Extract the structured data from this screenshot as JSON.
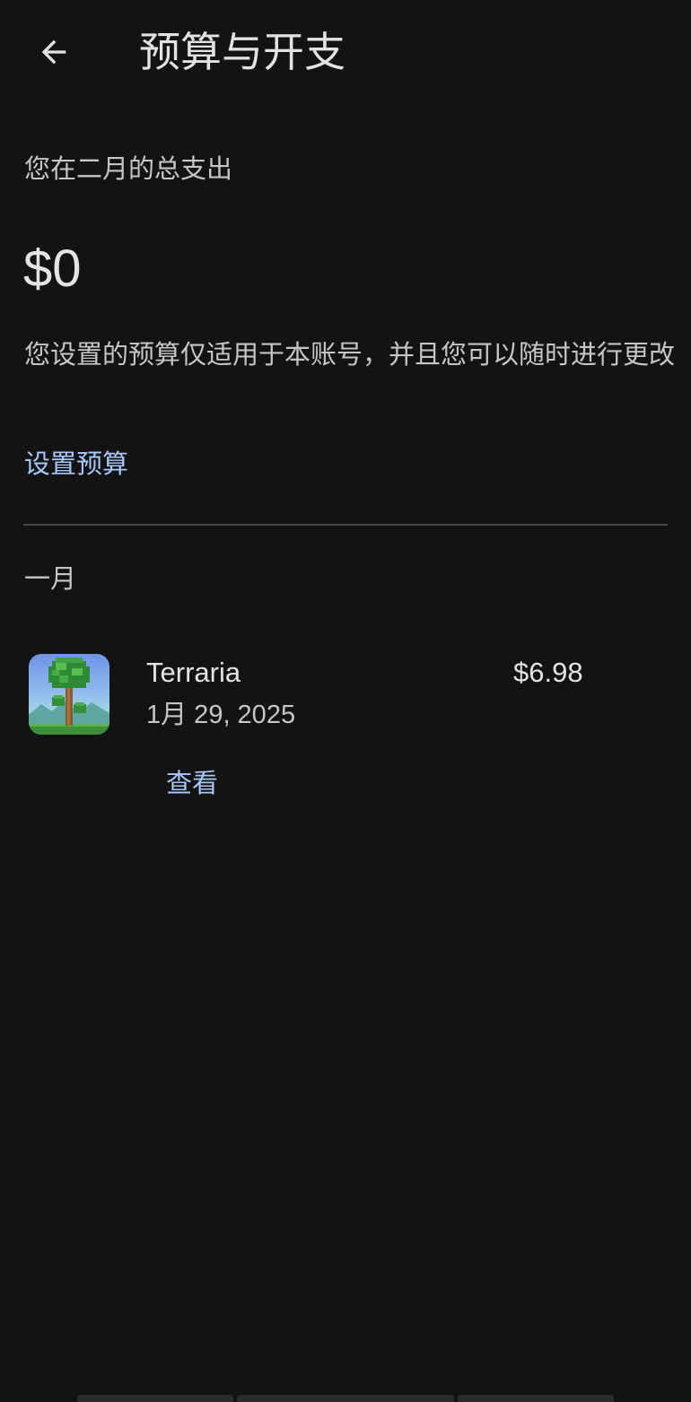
{
  "header": {
    "title": "预算与开支",
    "back_icon": "arrow-left-icon"
  },
  "summary": {
    "label": "您在二月的总支出",
    "amount": "$0",
    "description": "您设置的预算仅适用于本账号，并且您可以随时进行更改",
    "set_budget_label": "设置预算"
  },
  "history": {
    "month": "一月",
    "transactions": [
      {
        "app_name": "Terraria",
        "date": "1月 29, 2025",
        "price": "$6.98",
        "view_label": "查看",
        "icon": "terraria-app-icon"
      }
    ]
  },
  "colors": {
    "background": "#131313",
    "primary_text": "#e3e3e3",
    "secondary_text": "#c4c7c5",
    "link": "#a8c7fa",
    "divider": "#444746"
  }
}
